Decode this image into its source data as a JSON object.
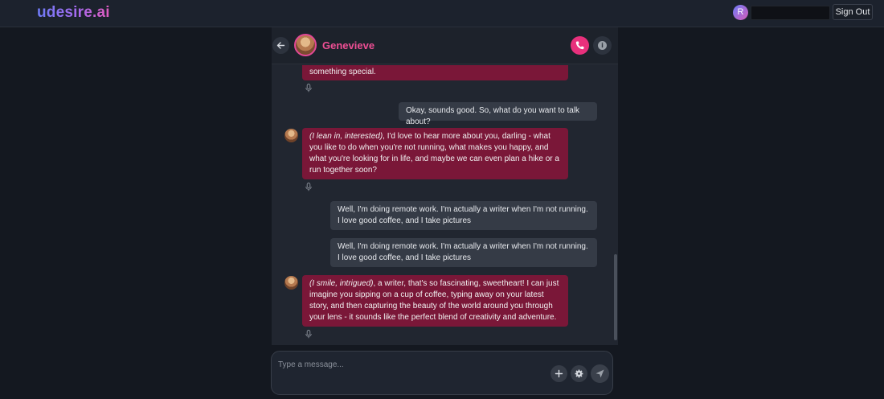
{
  "app": {
    "brand": "udesire.ai"
  },
  "user": {
    "initial": "R",
    "sign_out_label": "Sign Out"
  },
  "character": {
    "name": "Genevieve"
  },
  "messages": [
    {
      "role": "assistant",
      "text": "something special."
    },
    {
      "role": "user",
      "text": "Okay, sounds good. So, what do you want to talk about?"
    },
    {
      "role": "assistant",
      "action": "(I lean in, interested)",
      "text": ", I'd love to hear more about you, darling - what you like to do when you're not running, what makes you happy, and what you're looking for in life, and maybe we can even plan a hike or a run together soon?"
    },
    {
      "role": "user",
      "text": "Well, I'm doing remote work. I'm actually a writer when I'm not running. I love good coffee, and I take pictures"
    },
    {
      "role": "user",
      "text": "Well, I'm doing remote work. I'm actually a writer when I'm not running. I love good coffee, and I take pictures"
    },
    {
      "role": "assistant",
      "action": "(I smile, intrigued)",
      "text": ", a writer, that's so fascinating, sweetheart! I can just imagine you sipping on a cup of coffee, typing away on your latest story, and then capturing the beauty of the world around you through your lens - it sounds like the perfect blend of creativity and adventure."
    }
  ],
  "composer": {
    "placeholder": "Type a message..."
  },
  "icons": {
    "back": "arrow-left-icon",
    "call": "phone-icon",
    "info": "info-icon",
    "mic": "microphone-icon",
    "add": "plus-icon",
    "settings": "gear-icon",
    "send": "send-icon"
  },
  "colors": {
    "accent": "#e8307c",
    "bot_bubble": "#7a1738",
    "user_bubble": "#353b46",
    "character_name": "#ee4f94"
  }
}
